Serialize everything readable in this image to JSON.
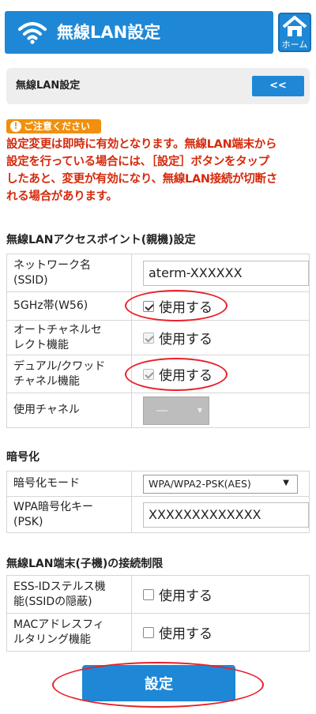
{
  "header": {
    "title": "無線LAN設定",
    "home_label": "ホーム"
  },
  "breadcrumb": {
    "label": "無線LAN設定",
    "back_label": "<<"
  },
  "caution": {
    "badge": "ご注意ください",
    "icon_glyph": "!",
    "lines": [
      "設定変更は即時に有効となります。無線LAN端末から",
      "設定を行っている場合には、［設定］ボタンをタップ",
      "したあと、変更が有効になり、無線LAN接続が切断さ",
      "れる場合があります。"
    ]
  },
  "ap_section": {
    "title": "無線LANアクセスポイント(親機)設定",
    "ssid": {
      "label_lines": [
        "ネットワーク名",
        "(SSID)"
      ],
      "value": "aterm-XXXXXX"
    },
    "band_5ghz": {
      "label": "5GHz帯(W56)",
      "option": "使用する",
      "checked": true
    },
    "auto_channel": {
      "label_lines": [
        "オートチャネルセ",
        "レクト機能"
      ],
      "option": "使用する",
      "checked": true
    },
    "dual_quad": {
      "label_lines": [
        "デュアル/クワッド",
        "チャネル機能"
      ],
      "option": "使用する",
      "checked": true
    },
    "channel": {
      "label": "使用チャネル",
      "value": "―"
    }
  },
  "enc_section": {
    "title": "暗号化",
    "mode": {
      "label": "暗号化モード",
      "value": "WPA/WPA2-PSK(AES)"
    },
    "psk": {
      "label_lines": [
        "WPA暗号化キー",
        "(PSK)"
      ],
      "value": "XXXXXXXXXXXXX"
    }
  },
  "limit_section": {
    "title": "無線LAN端末(子機)の接続制限",
    "stealth": {
      "label_lines": [
        "ESS-IDステルス機",
        "能(SSIDの隠蔽)"
      ],
      "option": "使用する",
      "checked": false
    },
    "mac_filter": {
      "label_lines": [
        "MACアドレスフィ",
        "ルタリング機能"
      ],
      "option": "使用する",
      "checked": false
    }
  },
  "submit_label": "設定",
  "colors": {
    "primary": "#1e88d6",
    "caution_badge": "#f0900c",
    "caution_text": "#d42a0c",
    "annotation": "#e8202a"
  }
}
